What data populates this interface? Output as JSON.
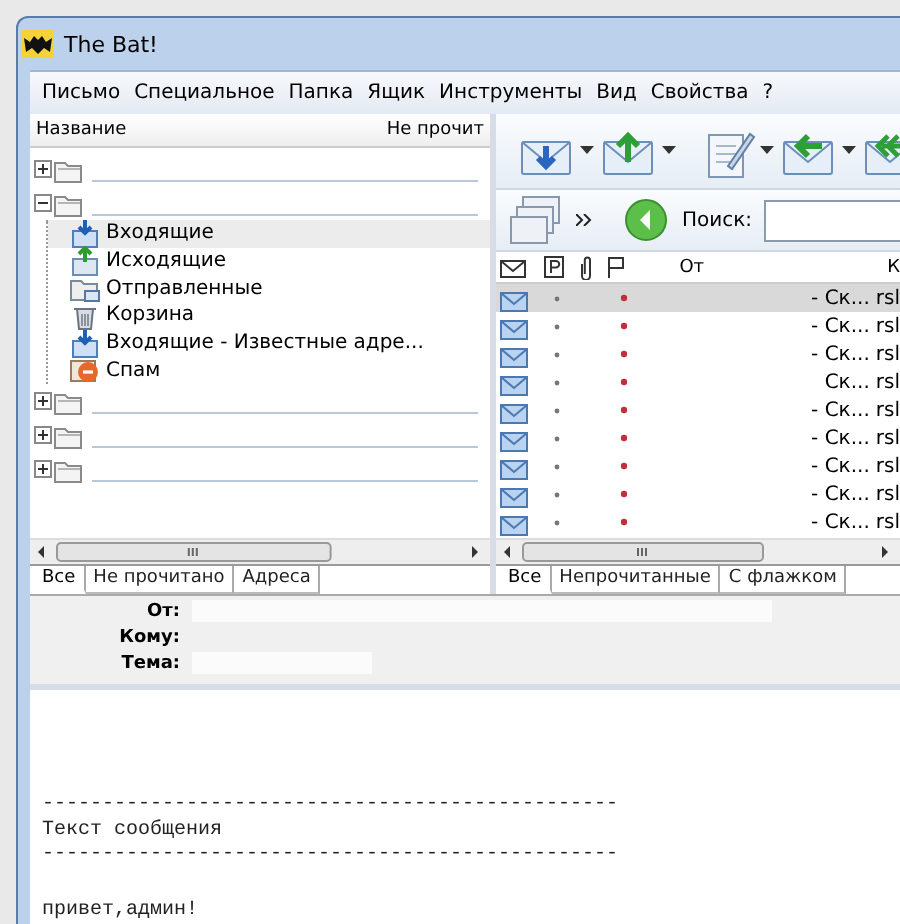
{
  "window": {
    "title": "The Bat!"
  },
  "menu": [
    "Письмо",
    "Специальное",
    "Папка",
    "Ящик",
    "Инструменты",
    "Вид",
    "Свойства",
    "?"
  ],
  "folders": {
    "columns": [
      "Название",
      "Не прочит"
    ],
    "items": [
      {
        "expanded": false
      },
      {
        "expanded": true,
        "children": [
          {
            "name": "Входящие",
            "kind": "inbox",
            "selected": true
          },
          {
            "name": "Исходящие",
            "kind": "outbox",
            "selected": false
          },
          {
            "name": "Отправленные",
            "kind": "sent",
            "selected": false
          },
          {
            "name": "Корзина",
            "kind": "trash",
            "selected": false
          },
          {
            "name": "Входящие - Известные адре...",
            "kind": "inbox",
            "selected": false
          },
          {
            "name": "Спам",
            "kind": "spam",
            "selected": false
          }
        ]
      },
      {
        "expanded": false
      },
      {
        "expanded": false
      },
      {
        "expanded": false
      }
    ]
  },
  "folder_tabs": [
    {
      "label": "Все",
      "selected": true
    },
    {
      "label": "Не прочитано",
      "selected": false
    },
    {
      "label": "Адреса",
      "selected": false
    }
  ],
  "search": {
    "label": "Поиск:"
  },
  "messages": {
    "columns": [
      "От",
      "К"
    ],
    "rows": [
      {
        "selected": true,
        "from": "- Ск...",
        "to": "rsl"
      },
      {
        "selected": false,
        "from": "- Ск...",
        "to": "rsl"
      },
      {
        "selected": false,
        "from": "- Ск...",
        "to": "rsl"
      },
      {
        "selected": false,
        "from": "Ск...",
        "to": "rsl"
      },
      {
        "selected": false,
        "from": "- Ск...",
        "to": "rsl"
      },
      {
        "selected": false,
        "from": "- Ск...",
        "to": "rsl"
      },
      {
        "selected": false,
        "from": "- Ск...",
        "to": "rsl"
      },
      {
        "selected": false,
        "from": "- Ск...",
        "to": "rsl"
      },
      {
        "selected": false,
        "from": "- Ск...",
        "to": "rsl"
      }
    ]
  },
  "message_tabs": [
    {
      "label": "Все",
      "selected": true
    },
    {
      "label": "Непрочитанные",
      "selected": false
    },
    {
      "label": "С флажком",
      "selected": false
    }
  ],
  "header": {
    "fields": [
      {
        "label": "От:"
      },
      {
        "label": "Кому:"
      },
      {
        "label": "Тема:"
      }
    ]
  },
  "body": {
    "blocks": [
      [
        "------------------------------------------------",
        "Текст сообщения",
        "------------------------------------------------"
      ],
      [
        "привет,админ!"
      ]
    ]
  }
}
